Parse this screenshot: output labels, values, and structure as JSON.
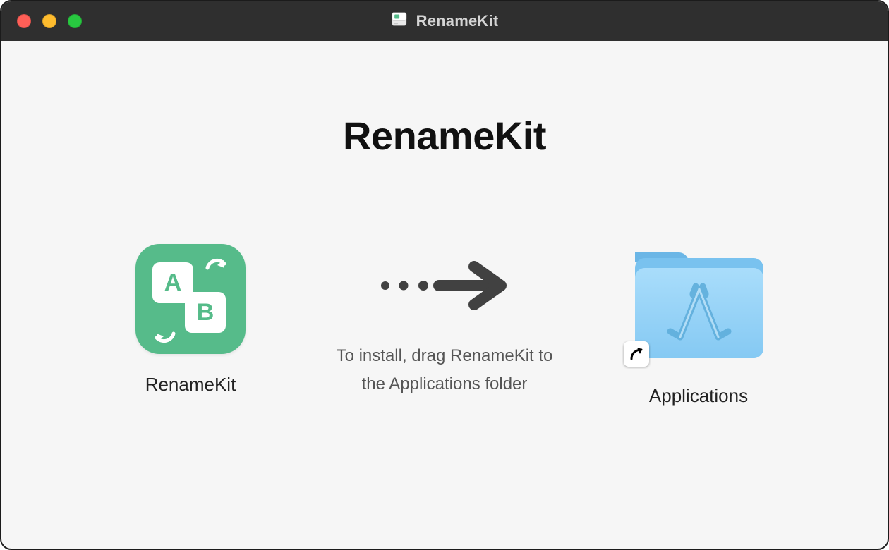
{
  "window": {
    "title": "RenameKit"
  },
  "main": {
    "heading": "RenameKit",
    "instruction": "To install, drag RenameKit to the Applications folder",
    "app_label": "RenameKit",
    "dest_label": "Applications"
  },
  "icons": {
    "app_tile_a": "A",
    "app_tile_b": "B"
  },
  "colors": {
    "titlebar_bg": "#2f2f2f",
    "content_bg": "#f6f6f6",
    "app_icon_bg": "#56bb8a",
    "folder_fill": "#8fcff6",
    "folder_tab": "#6bb6e6",
    "arrow": "#414141"
  }
}
